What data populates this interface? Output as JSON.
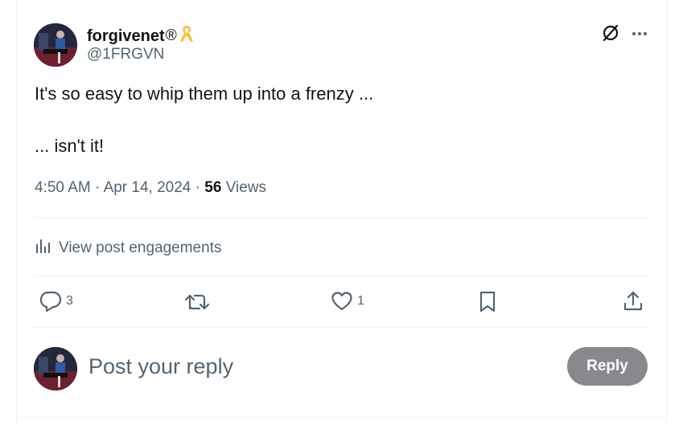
{
  "author": {
    "display_name": "forgivenet",
    "registered_mark": "®",
    "handle": "@1FRGVN",
    "badge_icon": "yellow-ribbon-icon",
    "badge_color": "#f5c33b"
  },
  "tweet": {
    "line1": "It's so easy to whip them up into a frenzy ...",
    "line2": "... isn't it!",
    "time": "4:50 AM",
    "date": "Apr 14, 2024",
    "separator": "·",
    "views_count": "56",
    "views_label": "Views"
  },
  "engagements": {
    "label": "View post engagements"
  },
  "actions": {
    "reply_count": "3",
    "like_count": "1"
  },
  "reply_box": {
    "placeholder": "Post your reply",
    "button_label": "Reply"
  },
  "colors": {
    "text_primary": "#0f1419",
    "text_secondary": "#536471",
    "divider": "#eff3f4",
    "reply_button": "#87898c"
  }
}
